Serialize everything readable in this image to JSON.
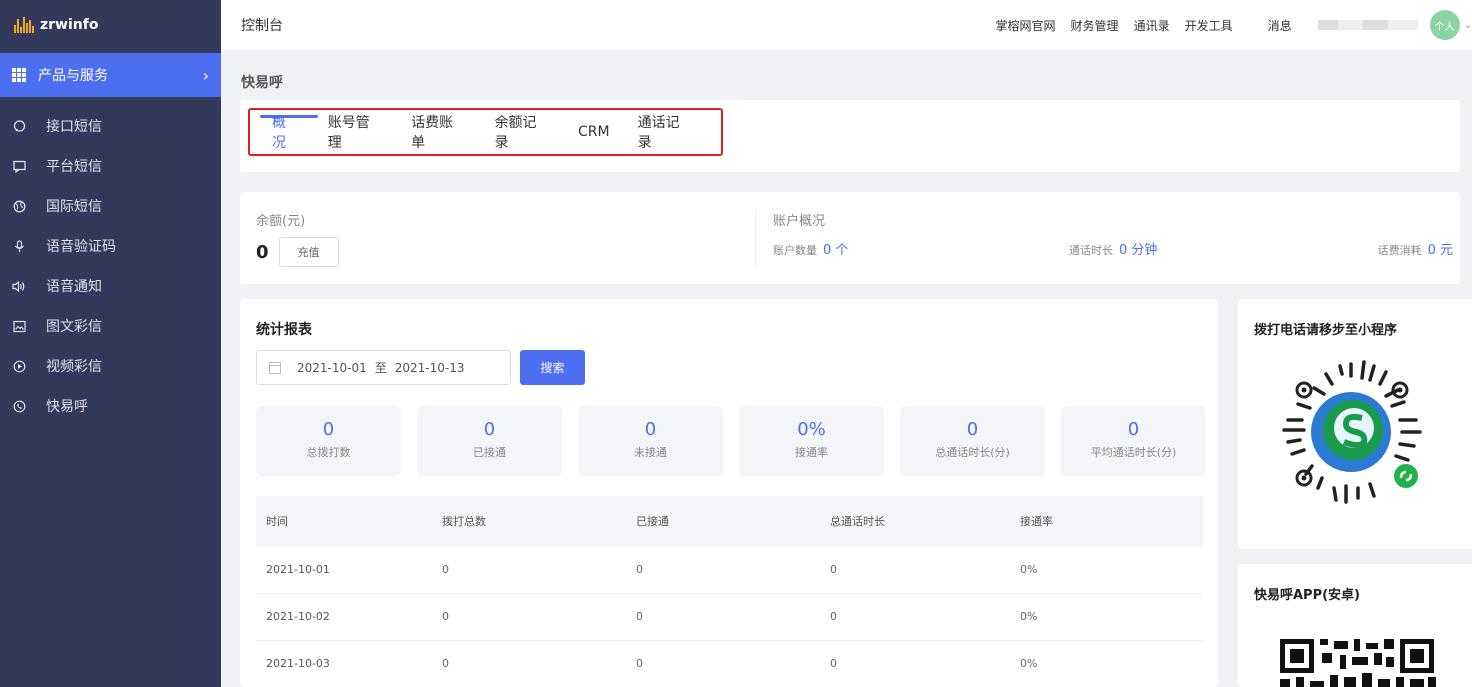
{
  "brand": {
    "name": "zrwinfo"
  },
  "sidebar": {
    "group_label": "产品与服务",
    "items": [
      {
        "label": "接口短信",
        "icon": "chat-bubble-icon"
      },
      {
        "label": "平台短信",
        "icon": "message-icon"
      },
      {
        "label": "国际短信",
        "icon": "globe-icon"
      },
      {
        "label": "语音验证码",
        "icon": "microphone-icon"
      },
      {
        "label": "语音通知",
        "icon": "speaker-icon"
      },
      {
        "label": "图文彩信",
        "icon": "image-icon"
      },
      {
        "label": "视频彩信",
        "icon": "play-icon"
      },
      {
        "label": "快易呼",
        "icon": "phone-circle-icon"
      }
    ]
  },
  "topbar": {
    "title": "控制台",
    "links": [
      "掌榕网官网",
      "财务管理",
      "通讯录",
      "开发工具"
    ],
    "messages": "消息",
    "avatar": "个人"
  },
  "page": {
    "breadcrumb": "快易呼",
    "tabs": [
      "概况",
      "账号管理",
      "话费账单",
      "余额记录",
      "CRM",
      "通话记录"
    ],
    "active_tab": "概况"
  },
  "balance": {
    "label": "余额(元)",
    "value": "0",
    "charge_button": "充值"
  },
  "account": {
    "label": "账户概况",
    "count_label": "账户数量",
    "count_value": "0 个",
    "duration_label": "通话时长",
    "duration_value": "0 分钟",
    "cost_label": "话费消耗",
    "cost_value": "0 元"
  },
  "report": {
    "title": "统计报表",
    "date_from": "2021-10-01",
    "date_sep": "至",
    "date_to": "2021-10-13",
    "search_button": "搜索",
    "kpis": [
      {
        "value": "0",
        "label": "总拨打数"
      },
      {
        "value": "0",
        "label": "已接通"
      },
      {
        "value": "0",
        "label": "未接通"
      },
      {
        "value": "0%",
        "label": "接通率"
      },
      {
        "value": "0",
        "label": "总通话时长(分)"
      },
      {
        "value": "0",
        "label": "平均通话时长(分)"
      }
    ],
    "table": {
      "headers": [
        "时间",
        "拨打总数",
        "已接通",
        "总通话时长",
        "接通率"
      ],
      "rows": [
        [
          "2021-10-01",
          "0",
          "0",
          "0",
          "0%"
        ],
        [
          "2021-10-02",
          "0",
          "0",
          "0",
          "0%"
        ],
        [
          "2021-10-03",
          "0",
          "0",
          "0",
          "0%"
        ]
      ]
    }
  },
  "side": {
    "miniprogram_title": "拨打电话请移步至小程序",
    "app_title": "快易呼APP(安卓)"
  },
  "colors": {
    "accent": "#4e6ef2",
    "sidebar": "#33395a",
    "highlight": "#e02020"
  }
}
